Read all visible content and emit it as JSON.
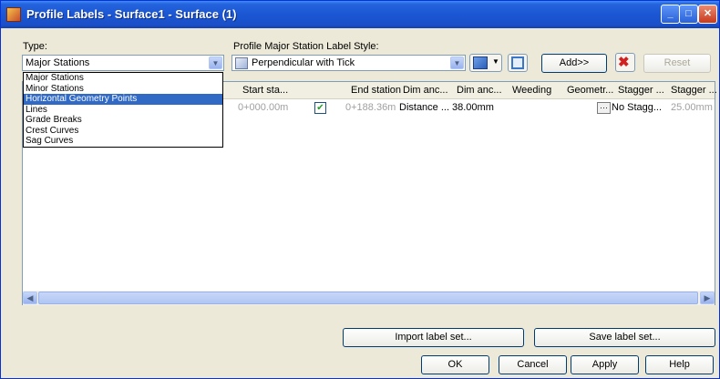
{
  "window": {
    "title": "Profile Labels - Surface1 - Surface (1)",
    "min_glyph": "_",
    "max_glyph": "□",
    "close_glyph": "✕"
  },
  "type": {
    "label": "Type:",
    "selected": "Major Stations",
    "options": [
      "Major Stations",
      "Minor Stations",
      "Horizontal Geometry Points",
      "Lines",
      "Grade Breaks",
      "Crest Curves",
      "Sag Curves"
    ],
    "highlighted_index": 2
  },
  "style": {
    "label": "Profile Major Station Label Style:",
    "selected": "Perpendicular with Tick"
  },
  "buttons": {
    "add": "Add>>",
    "reset": "Reset",
    "import": "Import label set...",
    "save": "Save label set...",
    "ok": "OK",
    "cancel": "Cancel",
    "apply": "Apply",
    "help": "Help"
  },
  "grid": {
    "columns": [
      "Start sta...",
      "End station",
      "Dim anc...",
      "Dim anc...",
      "Weeding",
      "Geometr...",
      "Stagger ...",
      "Stagger ..."
    ],
    "row": {
      "start_station": "0+000.00m",
      "end_station": "0+188.36m",
      "dim_anchor_option": "Distance ...",
      "dim_anchor_value": "38.00mm",
      "weeding": "",
      "geometry_button": "···",
      "stagger_labels": "No Stagg...",
      "stagger_line_height": "25.00mm",
      "checked": true
    }
  },
  "icons": {
    "style_icon": "style-icon",
    "edit_icon": "edit-style-icon",
    "browse_icon": "browse-icon",
    "delete_icon": "delete-icon"
  },
  "colors": {
    "titlebar": "#1b56d3",
    "selection": "#316ac5",
    "delete": "#d12020"
  }
}
